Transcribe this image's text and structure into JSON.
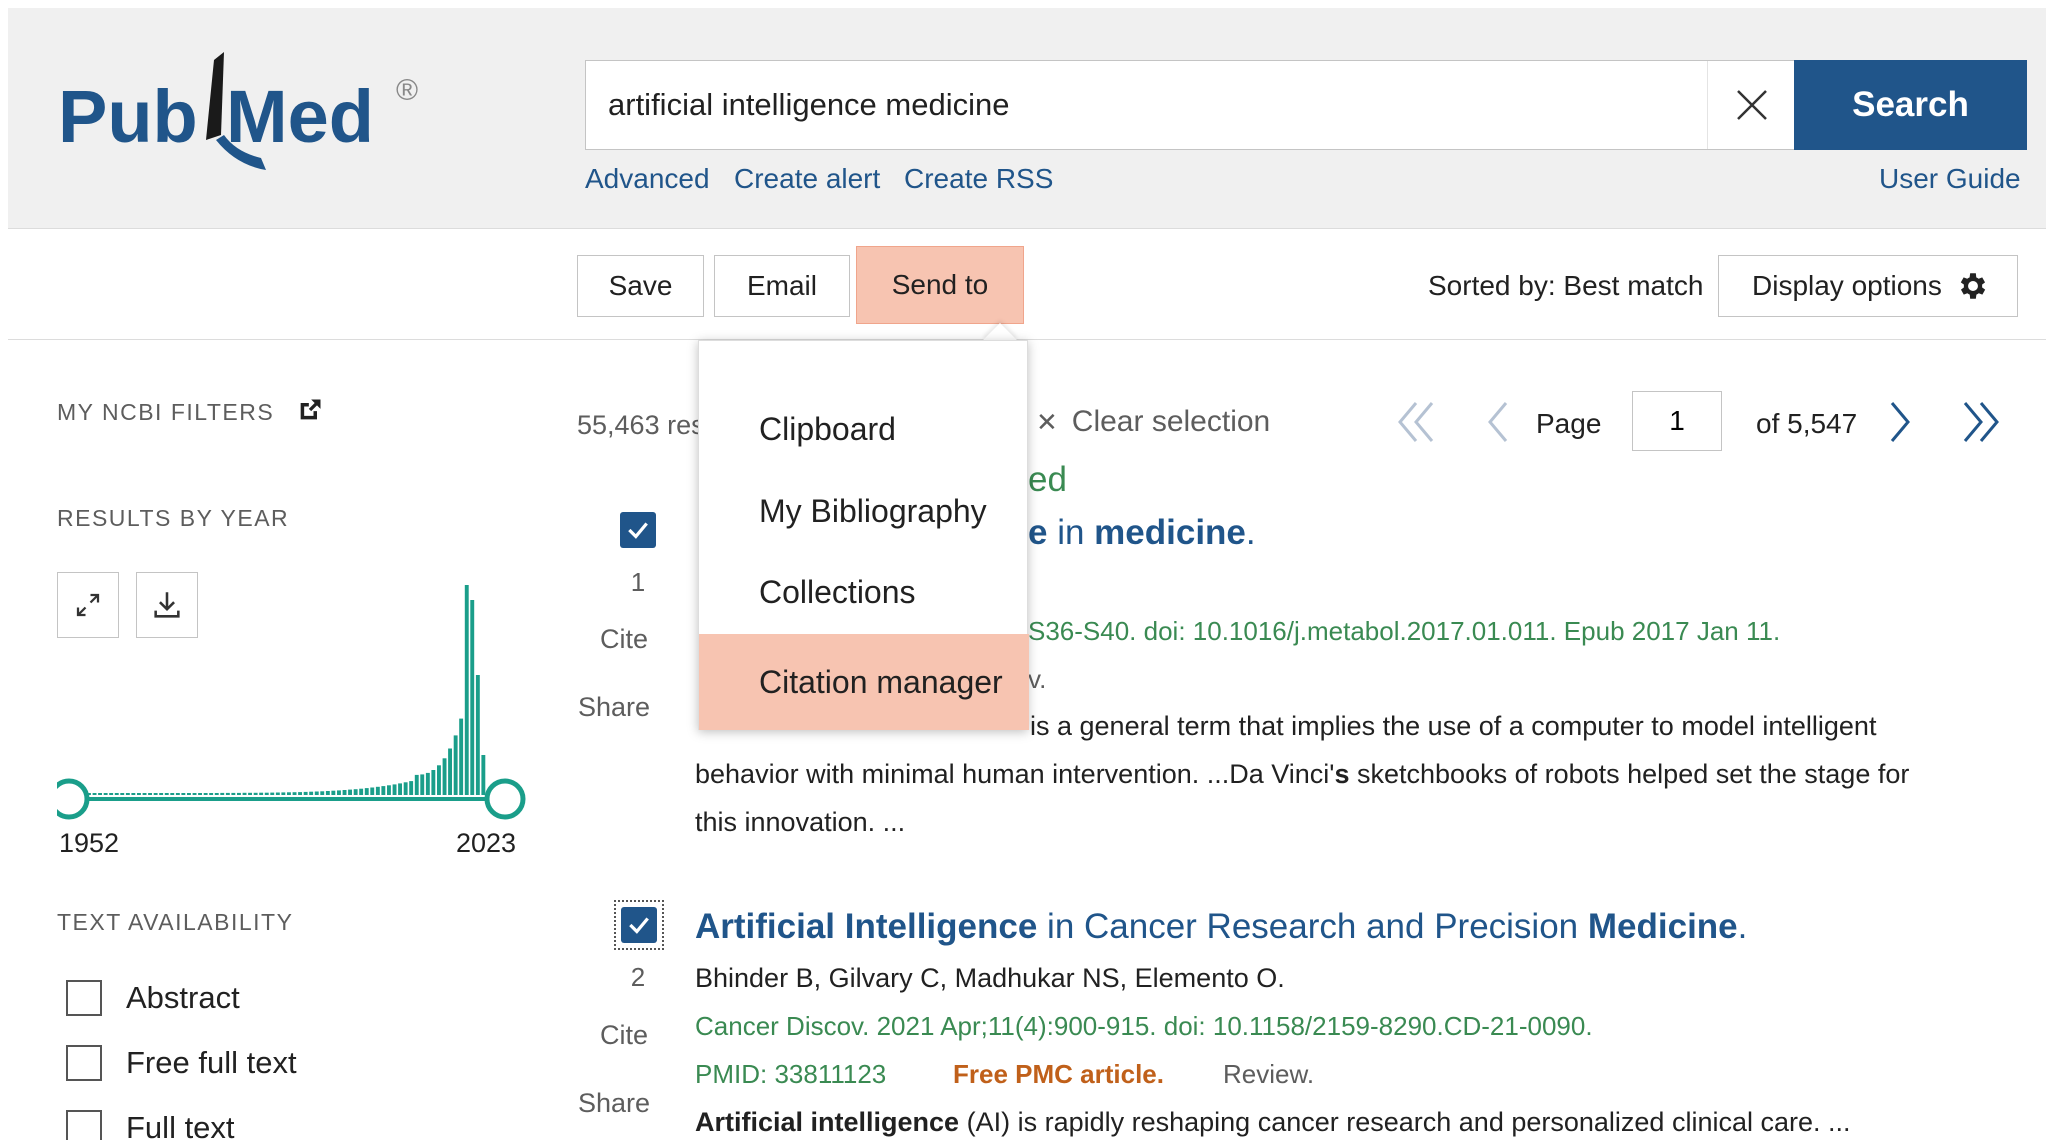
{
  "header": {
    "logo_text_left": "Pub",
    "logo_text_right": "Med",
    "logo_reg": "®",
    "search_value": "artificial intelligence medicine",
    "search_button": "Search",
    "clear_icon": "close-icon",
    "links": {
      "advanced": "Advanced",
      "create_alert": "Create alert",
      "create_rss": "Create RSS",
      "user_guide": "User Guide"
    }
  },
  "toolbar": {
    "save": "Save",
    "email": "Email",
    "send_to": "Send to",
    "sorted_by": "Sorted by: Best match",
    "display_options": "Display options",
    "gear_icon": "gear-icon"
  },
  "send_to_menu": {
    "items": [
      "Clipboard",
      "My Bibliography",
      "Collections",
      "Citation manager"
    ],
    "highlighted": "Citation manager"
  },
  "sidebar": {
    "my_ncbi_filters": "MY NCBI FILTERS",
    "results_by_year": "RESULTS BY YEAR",
    "year_start": "1952",
    "year_end": "2023",
    "text_availability": "TEXT AVAILABILITY",
    "filters": [
      "Abstract",
      "Free full text",
      "Full text"
    ]
  },
  "results_bar": {
    "count_partial": "55,463 res",
    "clear_selection": "Clear selection",
    "page_label": "Page",
    "page_value": "1",
    "of_pages": "of 5,547"
  },
  "articles": [
    {
      "number": "1",
      "cite": "Cite",
      "share": "Share",
      "status_fragment": "ed",
      "title_frag_bold1": "e",
      "title_frag_mid": " in ",
      "title_frag_bold2": "medicine",
      "title_frag_end": ".",
      "citation_partial": "S36-S40. doi: 10.1016/j.metabol.2017.01.011. Epub 2017 Jan 11.",
      "line2_partial": "v.",
      "snippet_line1": "is a general term that implies the use of a computer to model intelligent",
      "snippet_line2_a": "behavior with minimal human intervention. ...Da Vinci'",
      "snippet_line2_b": "s",
      "snippet_line2_c": " sketchbooks of robots helped set the stage for",
      "snippet_line3": "this innovation. ..."
    },
    {
      "number": "2",
      "cite": "Cite",
      "share": "Share",
      "title_bold1": "Artificial Intelligence",
      "title_mid": " in Cancer Research and Precision ",
      "title_bold2": "Medicine",
      "title_end": ".",
      "authors": "Bhinder B, Gilvary C, Madhukar NS, Elemento O.",
      "citation": "Cancer Discov. 2021 Apr;11(4):900-915. doi: 10.1158/2159-8290.CD-21-0090.",
      "pmid": "PMID: 33811123",
      "free_pmc": "Free PMC article.",
      "review": "Review.",
      "snippet_bold": "Artificial intelligence",
      "snippet_rest": " (AI) is rapidly reshaping cancer research and personalized clinical care. ..."
    }
  ],
  "colors": {
    "brand_blue": "#20558a",
    "histogram_teal": "#1a9e8a",
    "citation_green": "#3a8a52",
    "free_pmc_orange": "#c0601a",
    "highlight_salmon": "#f7c4b1"
  }
}
